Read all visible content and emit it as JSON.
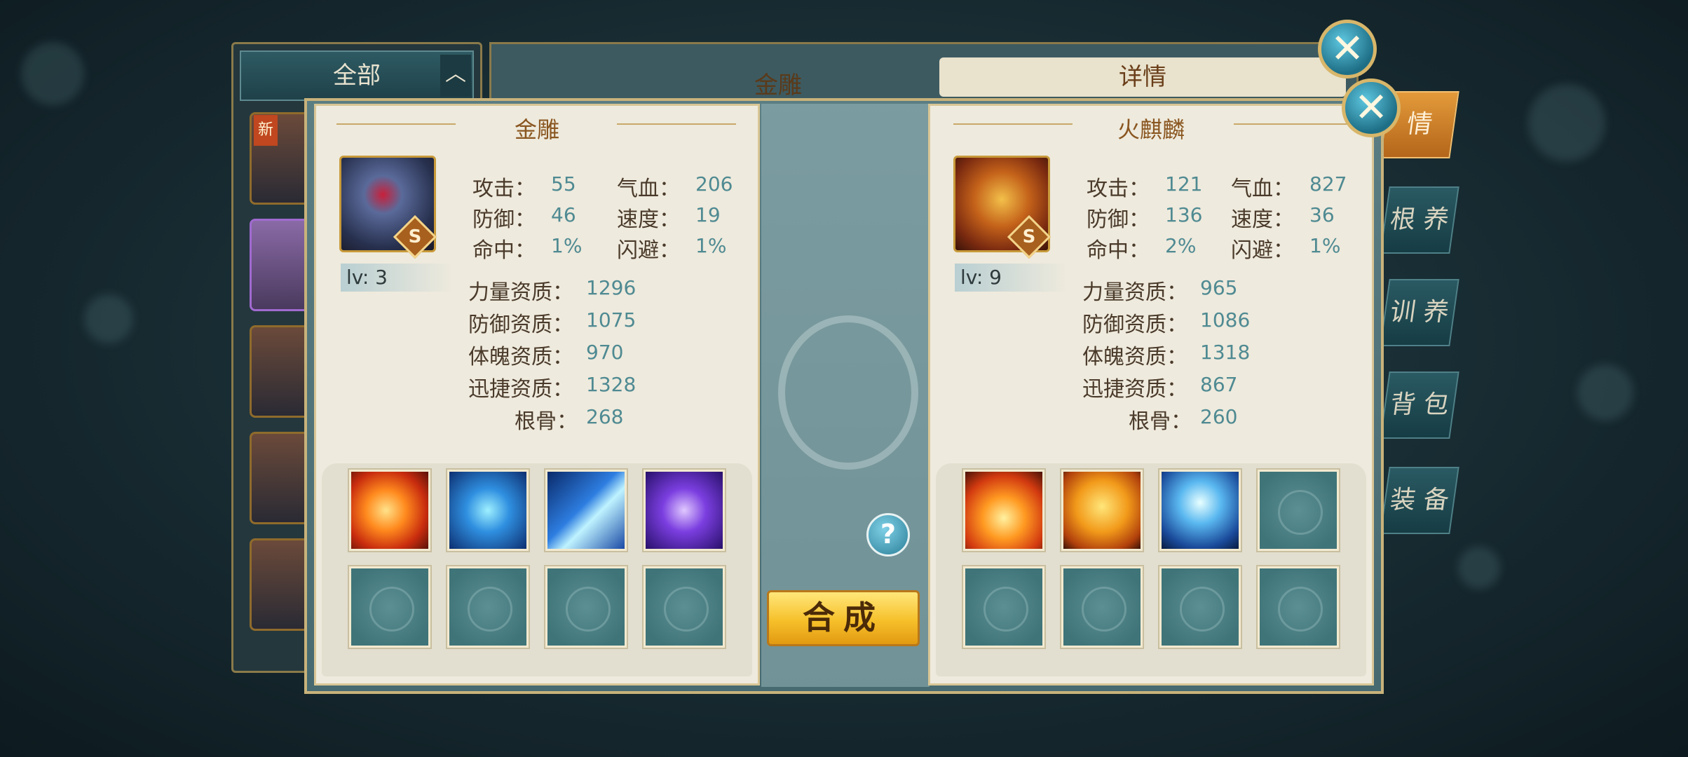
{
  "background_list": {
    "filter_label": "全部",
    "arrow": "chevron-up-icon",
    "new_badge": "新"
  },
  "background_main": {
    "title": "金雕",
    "detail_title": "详情"
  },
  "side_tabs": [
    "情",
    "根 养",
    "训 养",
    "背 包",
    "装 备"
  ],
  "left_pet": {
    "name": "金雕",
    "grade": "S",
    "level": "lv: 3",
    "stats": [
      {
        "label": "攻击：",
        "value": "55"
      },
      {
        "label": "气血：",
        "value": "206"
      },
      {
        "label": "防御：",
        "value": "46"
      },
      {
        "label": "速度：",
        "value": "19"
      },
      {
        "label": "命中：",
        "value": "1%"
      },
      {
        "label": "闪避：",
        "value": "1%"
      }
    ],
    "aptitudes": [
      {
        "label": "力量资质：",
        "value": "1296"
      },
      {
        "label": "防御资质：",
        "value": "1075"
      },
      {
        "label": "体魄资质：",
        "value": "970"
      },
      {
        "label": "迅捷资质：",
        "value": "1328"
      },
      {
        "label": "根骨：",
        "value": "268"
      }
    ],
    "skills": [
      "fire-bird-skill-icon",
      "blue-cross-skill-icon",
      "blue-blade-skill-icon",
      "purple-vortex-skill-icon",
      "empty",
      "empty",
      "empty",
      "empty"
    ]
  },
  "right_pet": {
    "name": "火麒麟",
    "grade": "S",
    "level": "lv: 9",
    "stats": [
      {
        "label": "攻击：",
        "value": "121"
      },
      {
        "label": "气血：",
        "value": "827"
      },
      {
        "label": "防御：",
        "value": "136"
      },
      {
        "label": "速度：",
        "value": "36"
      },
      {
        "label": "命中：",
        "value": "2%"
      },
      {
        "label": "闪避：",
        "value": "1%"
      }
    ],
    "aptitudes": [
      {
        "label": "力量资质：",
        "value": "965"
      },
      {
        "label": "防御资质：",
        "value": "1086"
      },
      {
        "label": "体魄资质：",
        "value": "1318"
      },
      {
        "label": "迅捷资质：",
        "value": "867"
      },
      {
        "label": "根骨：",
        "value": "260"
      }
    ],
    "skills": [
      "fire-burst-skill-icon",
      "fire-shield-skill-icon",
      "lightning-skill-icon",
      "empty",
      "empty",
      "empty",
      "empty",
      "empty"
    ]
  },
  "help_label": "?",
  "merge_button": "合成",
  "close_label": "✕"
}
